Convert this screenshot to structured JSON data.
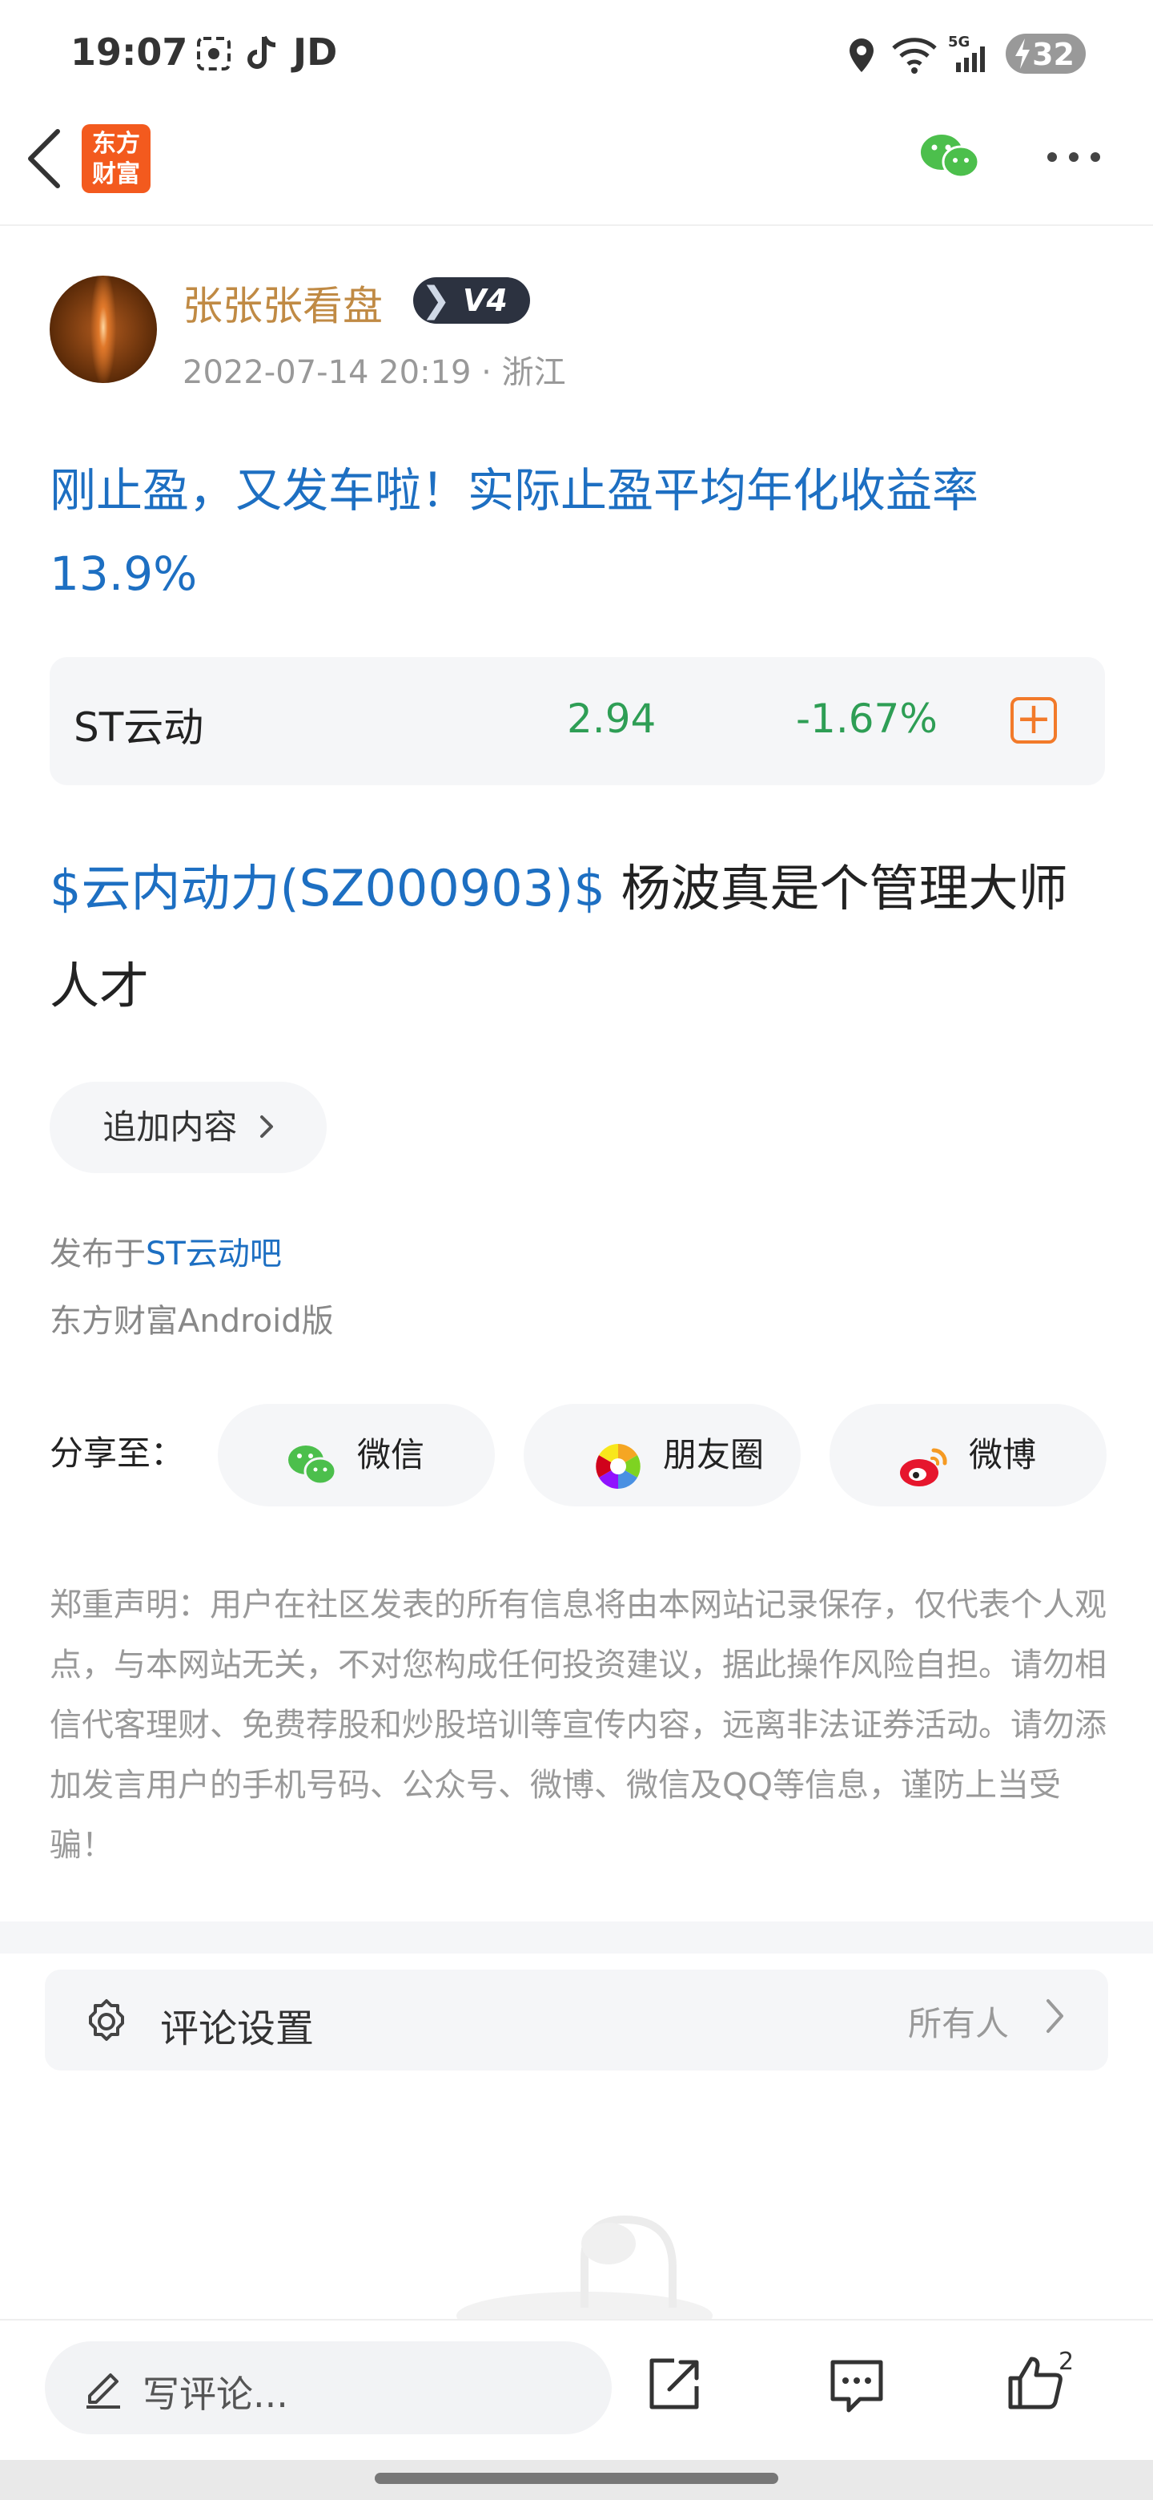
{
  "status_bar": {
    "time": "19:07",
    "app_label": "JD",
    "battery": "32"
  },
  "nav": {
    "logo_line1": "东方",
    "logo_line2": "财富"
  },
  "author": {
    "name": "张张张看盘",
    "level": "V4",
    "datetime": "2022-07-14 20:19 · 浙江"
  },
  "post": {
    "title": "刚止盈，又发车啦！实际止盈平均年化收益率13.9%",
    "body_link": "$云内动力(SZ000903)$",
    "body_text": " 杨波真是个管理大师人才",
    "append_label": "追加内容",
    "published_prefix": "发布于",
    "published_forum": "ST云动吧",
    "client": "东方财富Android版"
  },
  "stock": {
    "name": "ST云动",
    "price": "2.94",
    "change": "-1.67%",
    "change_color": "#2e9e55"
  },
  "share": {
    "label": "分享至：",
    "buttons": [
      {
        "label": "微信",
        "icon": "wechat-icon"
      },
      {
        "label": "朋友圈",
        "icon": "moments-icon"
      },
      {
        "label": "微博",
        "icon": "weibo-icon"
      }
    ]
  },
  "disclaimer": "郑重声明：用户在社区发表的所有信息将由本网站记录保存，仅代表个人观点，与本网站无关，不对您构成任何投资建议，据此操作风险自担。请勿相信代客理财、免费荐股和炒股培训等宣传内容，远离非法证券活动。请勿添加发言用户的手机号码、公众号、微博、微信及QQ等信息，谨防上当受骗！",
  "comment_settings": {
    "label": "评论设置",
    "value": "所有人"
  },
  "bottom_bar": {
    "placeholder": "写评论...",
    "like_count": "2"
  },
  "colors": {
    "brand_orange": "#f35a1e",
    "link_blue": "#1d6fc2",
    "stock_green": "#2e9e55"
  }
}
